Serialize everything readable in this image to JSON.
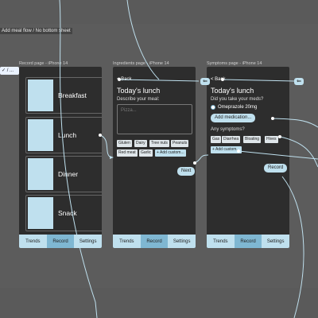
{
  "flow_label": "Add meal flow / No bottom sheet",
  "left_chip_text": "✓ / ...",
  "frames": {
    "record": {
      "title": "Record page - iPhone 14",
      "meals": [
        "Breakfast",
        "Lunch",
        "Dinner",
        "Snack"
      ]
    },
    "ingredients": {
      "title": "Ingredients page - iPhone 14",
      "back": "< Back",
      "heading": "Today's lunch",
      "prompt": "Describe your meal:",
      "placeholder": "Pizza...",
      "chips": [
        "Gluten",
        "Dairy",
        "Tree nuts",
        "Peanuts",
        "Red meat",
        "Garlic"
      ],
      "add_custom": "+ Add custom...",
      "next": "Next"
    },
    "symptoms": {
      "title": "Symptoms page - iPhone 14",
      "back": "< Back",
      "heading": "Today's lunch",
      "meds_q": "Did you take your meds?",
      "med_option": "Omeprazole 20mg",
      "add_med": "Add medication...",
      "symptoms_q": "Any symptoms?",
      "chips": [
        "Gas",
        "Diarrhea",
        "Bloating",
        "Hives"
      ],
      "add_custom": "+ Add custom...",
      "record": "Record"
    }
  },
  "tabs": [
    "Trends",
    "Record",
    "Settings"
  ],
  "active_tab": "Record",
  "colors": {
    "accent": "#7fb7d2",
    "accent_light": "#bfe0ee",
    "frame": "#2d2d2d",
    "canvas": "#5c5c5c"
  }
}
